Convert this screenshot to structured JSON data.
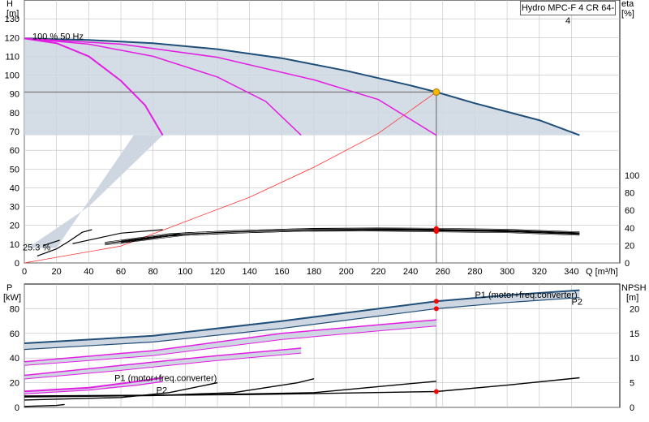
{
  "title": "Hydro MPC-F 4 CR 64-4",
  "colors": {
    "envelope_fill": "#cdd6e1",
    "max_curve": "#1f4e79",
    "speed_curve": "#e31ee3",
    "system_curve": "#ff3333",
    "eff_curve": "#000000",
    "duty_marker": "#f6b800",
    "point_marker": "#ff0000",
    "grid": "#c0c0c0",
    "p2_label": "#1f4e79"
  },
  "chart_data": [
    {
      "id": "top",
      "type": "line",
      "left_axis": {
        "title": [
          "H",
          "[m]"
        ],
        "range": [
          0,
          140
        ],
        "ticks": [
          0,
          10,
          20,
          30,
          40,
          50,
          60,
          70,
          80,
          90,
          100,
          110,
          120,
          130
        ]
      },
      "right_axis": {
        "title": [
          "eta",
          "[%]"
        ],
        "ticks": [
          0,
          20,
          40,
          60,
          80,
          100
        ]
      },
      "x_axis": {
        "label": "Q [m³/h]",
        "range": [
          0,
          370
        ],
        "ticks": [
          0,
          20,
          40,
          60,
          80,
          100,
          120,
          140,
          160,
          180,
          200,
          220,
          240,
          260,
          280,
          300,
          320,
          340
        ]
      },
      "annotations": [
        "100 %",
        "50 Hz",
        "25.3 %"
      ],
      "duty_point": {
        "q": 256,
        "h": 91
      },
      "curves": {
        "envelope": [
          [
            0,
            119.5
          ],
          [
            40,
            118.7
          ],
          [
            80,
            117
          ],
          [
            120,
            113.8
          ],
          [
            160,
            109
          ],
          [
            200,
            102.3
          ],
          [
            240,
            94.5
          ],
          [
            256,
            91
          ],
          [
            280,
            85
          ],
          [
            320,
            76
          ],
          [
            345,
            68
          ],
          [
            0,
            68
          ]
        ],
        "max_h": [
          [
            0,
            119.5
          ],
          [
            40,
            118.7
          ],
          [
            80,
            117
          ],
          [
            120,
            113.8
          ],
          [
            160,
            109
          ],
          [
            200,
            102.3
          ],
          [
            240,
            94.5
          ],
          [
            256,
            91
          ],
          [
            280,
            85
          ],
          [
            320,
            76
          ],
          [
            345,
            68
          ]
        ],
        "pumps_3": [
          [
            0,
            119.5
          ],
          [
            60,
            116.5
          ],
          [
            120,
            109.5
          ],
          [
            180,
            97.5
          ],
          [
            220,
            87
          ],
          [
            256,
            68
          ]
        ],
        "pumps_2": [
          [
            0,
            119.5
          ],
          [
            40,
            116.5
          ],
          [
            80,
            110
          ],
          [
            120,
            99
          ],
          [
            150,
            86
          ],
          [
            172,
            68
          ]
        ],
        "pumps_1": [
          [
            0,
            119.5
          ],
          [
            20,
            117
          ],
          [
            40,
            110
          ],
          [
            60,
            97
          ],
          [
            75,
            84
          ],
          [
            86,
            68
          ]
        ],
        "system": [
          [
            0,
            0
          ],
          [
            60,
            9
          ],
          [
            100,
            22
          ],
          [
            140,
            35
          ],
          [
            180,
            51
          ],
          [
            220,
            69
          ],
          [
            256,
            91
          ]
        ],
        "eta_4": [
          [
            60,
            24
          ],
          [
            100,
            33
          ],
          [
            140,
            36
          ],
          [
            180,
            38
          ],
          [
            220,
            38.5
          ],
          [
            256,
            38
          ],
          [
            300,
            37
          ],
          [
            345,
            34
          ]
        ],
        "eta_3": [
          [
            50,
            22
          ],
          [
            90,
            32
          ],
          [
            130,
            35.5
          ],
          [
            170,
            37.5
          ],
          [
            210,
            38
          ],
          [
            256,
            37
          ],
          [
            300,
            36
          ],
          [
            345,
            33
          ]
        ],
        "eta_2": [
          [
            30,
            22
          ],
          [
            60,
            34
          ],
          [
            86,
            38
          ]
        ],
        "eta_1": [
          [
            12,
            20
          ],
          [
            22,
            26
          ]
        ],
        "eta_partial": [
          [
            8,
            8
          ],
          [
            20,
            16
          ],
          [
            28,
            25
          ],
          [
            36,
            35
          ],
          [
            42,
            38
          ]
        ],
        "eta_points": [
          [
            256,
            36
          ],
          [
            256,
            37.7
          ],
          [
            256,
            39.2
          ]
        ]
      }
    },
    {
      "id": "bottom",
      "type": "line",
      "left_axis": {
        "title": [
          "P",
          "[kW]"
        ],
        "range": [
          0,
          100
        ],
        "ticks": [
          0,
          20,
          40,
          60,
          80
        ]
      },
      "right_axis": {
        "title": [
          "NPSH",
          "[m]"
        ],
        "range": [
          0,
          25
        ],
        "ticks": [
          0,
          5,
          10,
          15,
          20
        ]
      },
      "x_axis": {
        "range": [
          0,
          370
        ]
      },
      "labels": {
        "p1_top": "P1 (motor+freq.converter)",
        "p2_top": "P2",
        "p1_low": "P1 (motor+freq.converter)",
        "p2_low": "P2"
      },
      "curves": {
        "p1_4": [
          [
            0,
            52
          ],
          [
            80,
            58
          ],
          [
            160,
            70
          ],
          [
            220,
            80
          ],
          [
            256,
            86
          ],
          [
            300,
            91
          ],
          [
            345,
            95
          ]
        ],
        "p2_4": [
          [
            0,
            47
          ],
          [
            80,
            53
          ],
          [
            160,
            64
          ],
          [
            220,
            74
          ],
          [
            256,
            80
          ],
          [
            300,
            85
          ],
          [
            345,
            89
          ]
        ],
        "p1_3": [
          [
            0,
            37
          ],
          [
            80,
            46
          ],
          [
            160,
            60
          ],
          [
            220,
            67
          ],
          [
            256,
            71
          ]
        ],
        "p2_3": [
          [
            0,
            34
          ],
          [
            80,
            42
          ],
          [
            160,
            55
          ],
          [
            220,
            62
          ],
          [
            256,
            66
          ]
        ],
        "p1_2": [
          [
            0,
            26
          ],
          [
            60,
            34
          ],
          [
            120,
            42
          ],
          [
            172,
            48
          ]
        ],
        "p2_2": [
          [
            0,
            23
          ],
          [
            60,
            30
          ],
          [
            120,
            38
          ],
          [
            172,
            44
          ]
        ],
        "p1_1": [
          [
            0,
            13
          ],
          [
            40,
            16
          ],
          [
            70,
            21
          ],
          [
            86,
            24
          ]
        ],
        "p2_1": [
          [
            0,
            11
          ],
          [
            40,
            14
          ],
          [
            70,
            18
          ],
          [
            86,
            21
          ]
        ],
        "npsh_1": [
          [
            0,
            1.5
          ],
          [
            60,
            2
          ],
          [
            90,
            3
          ],
          [
            120,
            5
          ]
        ],
        "npsh_2": [
          [
            0,
            2.1
          ],
          [
            80,
            2.4
          ],
          [
            130,
            3
          ],
          [
            170,
            5
          ],
          [
            180,
            5.8
          ]
        ],
        "npsh_3": [
          [
            0,
            2.2
          ],
          [
            100,
            2.5
          ],
          [
            180,
            3
          ],
          [
            230,
            4.5
          ],
          [
            256,
            5.3
          ]
        ],
        "npsh_4": [
          [
            0,
            2.3
          ],
          [
            140,
            2.6
          ],
          [
            256,
            3.2
          ],
          [
            300,
            4.5
          ],
          [
            345,
            6
          ]
        ],
        "npsh_small": [
          [
            0,
            0.2
          ],
          [
            20,
            0.4
          ],
          [
            25,
            0.6
          ]
        ],
        "p_points": [
          [
            256,
            86
          ],
          [
            256,
            80
          ]
        ],
        "npsh_point": [
          [
            256,
            3.2
          ]
        ]
      }
    }
  ]
}
